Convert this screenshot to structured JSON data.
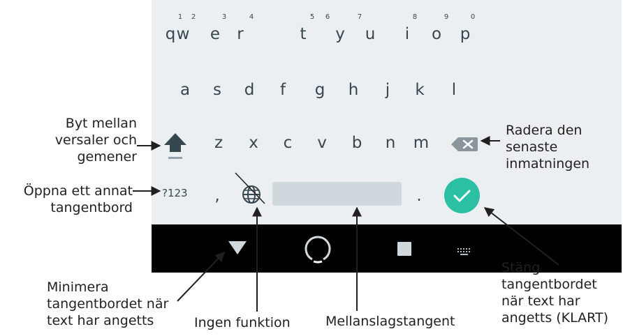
{
  "keyboard": {
    "row1": [
      {
        "letter": "q",
        "num": "1"
      },
      {
        "letter": "w",
        "num": "2"
      },
      {
        "letter": "e",
        "num": "3"
      },
      {
        "letter": "r",
        "num": "4"
      },
      {
        "letter": "t",
        "num": "5"
      },
      {
        "letter": "y",
        "num": "6"
      },
      {
        "letter": "u",
        "num": "7"
      },
      {
        "letter": "i",
        "num": "8"
      },
      {
        "letter": "o",
        "num": "9"
      },
      {
        "letter": "p",
        "num": "0"
      }
    ],
    "row2": [
      "a",
      "s",
      "d",
      "f",
      "g",
      "h",
      "j",
      "k",
      "l"
    ],
    "row3": [
      "z",
      "x",
      "c",
      "v",
      "b",
      "n",
      "m"
    ],
    "symbols_key": "?123",
    "comma_key": ",",
    "period_key": ".",
    "colors": {
      "background": "#eceff1",
      "keys": "#37474f",
      "done": "#2bbfa3",
      "spacebar": "#cfd8dc",
      "navbar": "#000000"
    }
  },
  "icons": {
    "shift": "shift-arrow-icon",
    "backspace": "backspace-icon",
    "globe": "globe-icon",
    "done": "checkmark-icon",
    "back": "triangle-down-icon",
    "home": "circle-home-icon",
    "recents": "square-recents-icon",
    "keyboard": "keyboard-icon"
  },
  "annotations": {
    "shift": [
      "Byt mellan",
      "versaler och",
      "gemener"
    ],
    "symbols": [
      "Öppna ett annat",
      "tangentbord"
    ],
    "delete": [
      "Radera den",
      "senaste",
      "inmatningen"
    ],
    "minimize": [
      "Minimera",
      "tangentbordet när",
      "text har angetts"
    ],
    "no_function": "Ingen funktion",
    "space": "Mellanslagstangent",
    "close": [
      "Stäng",
      "tangentbordet",
      "när text har",
      "angetts (KLART)"
    ]
  }
}
